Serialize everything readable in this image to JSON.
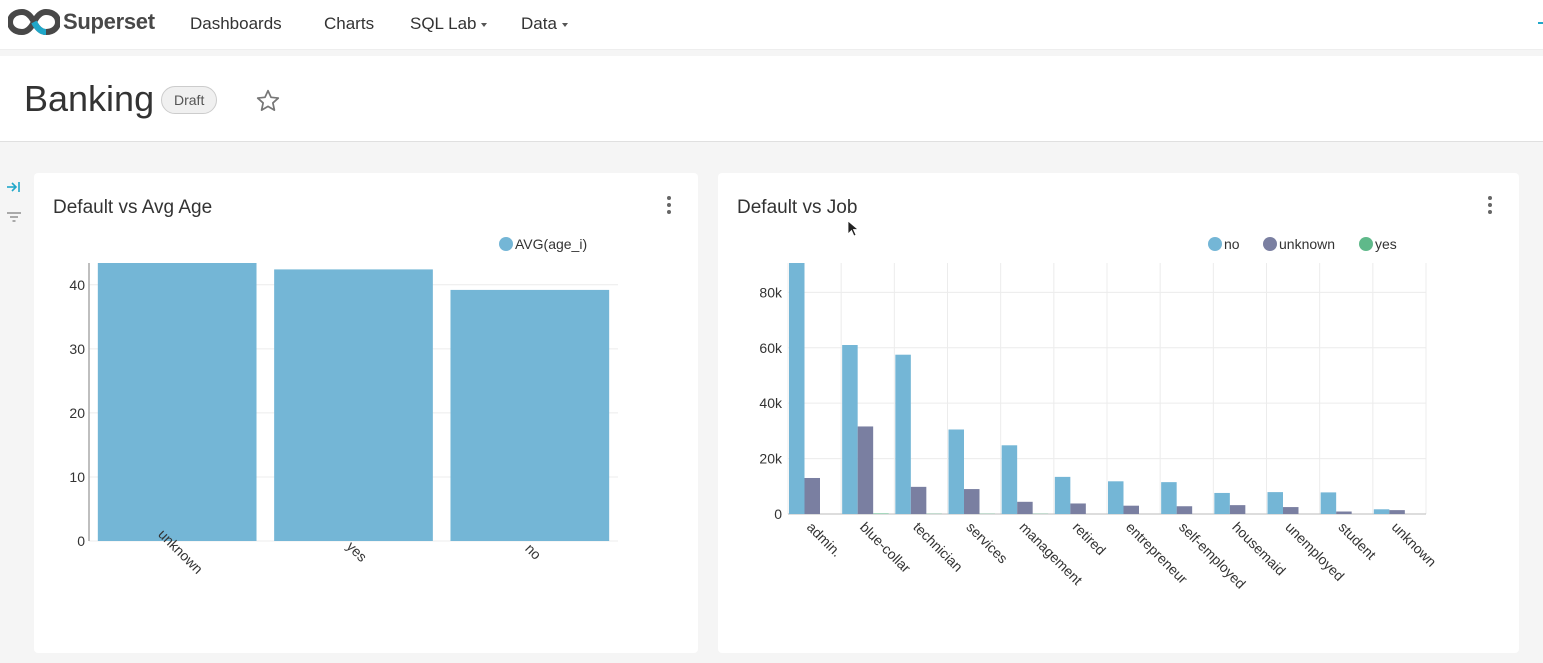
{
  "brand": {
    "name": "Superset"
  },
  "nav": {
    "dashboards": "Dashboards",
    "charts": "Charts",
    "sql_lab": "SQL Lab",
    "data": "Data"
  },
  "dashboard": {
    "title": "Banking",
    "status": "Draft"
  },
  "colors": {
    "no": "#74b6d6",
    "unknown": "#7a7fa1",
    "yes": "#5fb98a",
    "avg": "#74b6d6",
    "accent": "#20a7c9"
  },
  "cards": [
    {
      "title": "Default vs Avg Age"
    },
    {
      "title": "Default vs Job"
    }
  ],
  "chart_data": [
    {
      "type": "bar",
      "title": "Default vs Avg Age",
      "categories": [
        "unknown",
        "yes",
        "no"
      ],
      "series": [
        {
          "name": "AVG(age_i)",
          "values": [
            43.4,
            42.4,
            39.2
          ]
        }
      ],
      "ylim": [
        0,
        43.4
      ],
      "yticks": [
        0,
        10,
        20,
        30,
        40
      ],
      "grid": true,
      "legend": "top-right"
    },
    {
      "type": "bar",
      "title": "Default vs Job",
      "categories": [
        "admin.",
        "blue-collar",
        "technician",
        "services",
        "management",
        "retired",
        "entrepreneur",
        "self-employed",
        "housemaid",
        "unemployed",
        "student",
        "unknown"
      ],
      "series": [
        {
          "name": "no",
          "values": [
            90600,
            61000,
            57500,
            30500,
            24800,
            13400,
            11800,
            11500,
            7600,
            7900,
            7800,
            1700
          ]
        },
        {
          "name": "unknown",
          "values": [
            13000,
            31600,
            9800,
            9000,
            4400,
            3800,
            3000,
            2800,
            3200,
            2500,
            900,
            1400
          ]
        },
        {
          "name": "yes",
          "values": [
            0,
            200,
            100,
            100,
            100,
            0,
            0,
            0,
            0,
            0,
            0,
            0
          ]
        }
      ],
      "ylim": [
        0,
        90600
      ],
      "yticks": [
        0,
        20000,
        40000,
        60000,
        80000
      ],
      "yticklabels": [
        "0",
        "20k",
        "40k",
        "60k",
        "80k"
      ],
      "grid": true,
      "legend": "top-right"
    }
  ]
}
